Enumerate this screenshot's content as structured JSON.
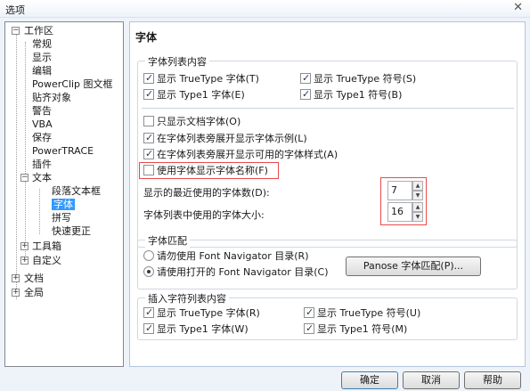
{
  "window": {
    "title": "选项",
    "close_icon": "close-icon"
  },
  "tree": {
    "items": [
      {
        "label": "工作区",
        "level": 0,
        "expander": "−"
      },
      {
        "label": "常规",
        "level": 1
      },
      {
        "label": "显示",
        "level": 1
      },
      {
        "label": "编辑",
        "level": 1
      },
      {
        "label": "PowerClip 图文框",
        "level": 1
      },
      {
        "label": "贴齐对象",
        "level": 1
      },
      {
        "label": "警告",
        "level": 1
      },
      {
        "label": "VBA",
        "level": 1
      },
      {
        "label": "保存",
        "level": 1
      },
      {
        "label": "PowerTRACE",
        "level": 1
      },
      {
        "label": "插件",
        "level": 1
      },
      {
        "label": "文本",
        "level": 1,
        "expander": "−"
      },
      {
        "label": "段落文本框",
        "level": 2
      },
      {
        "label": "字体",
        "level": 2,
        "selected": true
      },
      {
        "label": "拼写",
        "level": 2
      },
      {
        "label": "快速更正",
        "level": 2
      },
      {
        "label": "工具箱",
        "level": 1,
        "expander": "+"
      },
      {
        "label": "自定义",
        "level": 1,
        "expander": "+"
      },
      {
        "label": "文档",
        "level": 0,
        "expander": "+"
      },
      {
        "label": "全局",
        "level": 0,
        "expander": "+"
      }
    ]
  },
  "panel": {
    "title": "字体",
    "font_list_group": {
      "label": "字体列表内容",
      "checkboxes": [
        {
          "label": "显示 TrueType 字体(T)",
          "checked": true
        },
        {
          "label": "显示 TrueType 符号(S)",
          "checked": true
        },
        {
          "label": "显示 Type1 字体(E)",
          "checked": true
        },
        {
          "label": "显示 Type1 符号(B)",
          "checked": true
        },
        {
          "label": "只显示文档字体(O)",
          "checked": false
        },
        {
          "label": "在字体列表旁展开显示字体示例(L)",
          "checked": true
        },
        {
          "label": "在字体列表旁展开显示可用的字体样式(A)",
          "checked": true
        },
        {
          "label": "使用字体显示字体名称(F)",
          "checked": false
        }
      ],
      "recent_count_label": "显示的最近使用的字体数(D):",
      "recent_count_value": "7",
      "font_size_label": "字体列表中使用的字体大小:",
      "font_size_value": "16"
    },
    "match_group": {
      "label": "字体匹配",
      "radios": [
        {
          "label": "请勿使用 Font Navigator 目录(R)",
          "checked": false
        },
        {
          "label": "请使用打开的 Font Navigator 目录(C)",
          "checked": true
        }
      ],
      "panose_button": "Panose 字体匹配(P)..."
    },
    "insert_group": {
      "label": "插入字符列表内容",
      "checkboxes": [
        {
          "label": "显示 TrueType 字体(R)",
          "checked": true
        },
        {
          "label": "显示 TrueType 符号(U)",
          "checked": true
        },
        {
          "label": "显示 Type1 字体(W)",
          "checked": true
        },
        {
          "label": "显示 Type1 符号(M)",
          "checked": true
        }
      ]
    }
  },
  "buttons": {
    "ok": "确定",
    "cancel": "取消",
    "help": "帮助"
  },
  "colors": {
    "highlight": "#e84a4a",
    "selection": "#3399ff"
  }
}
